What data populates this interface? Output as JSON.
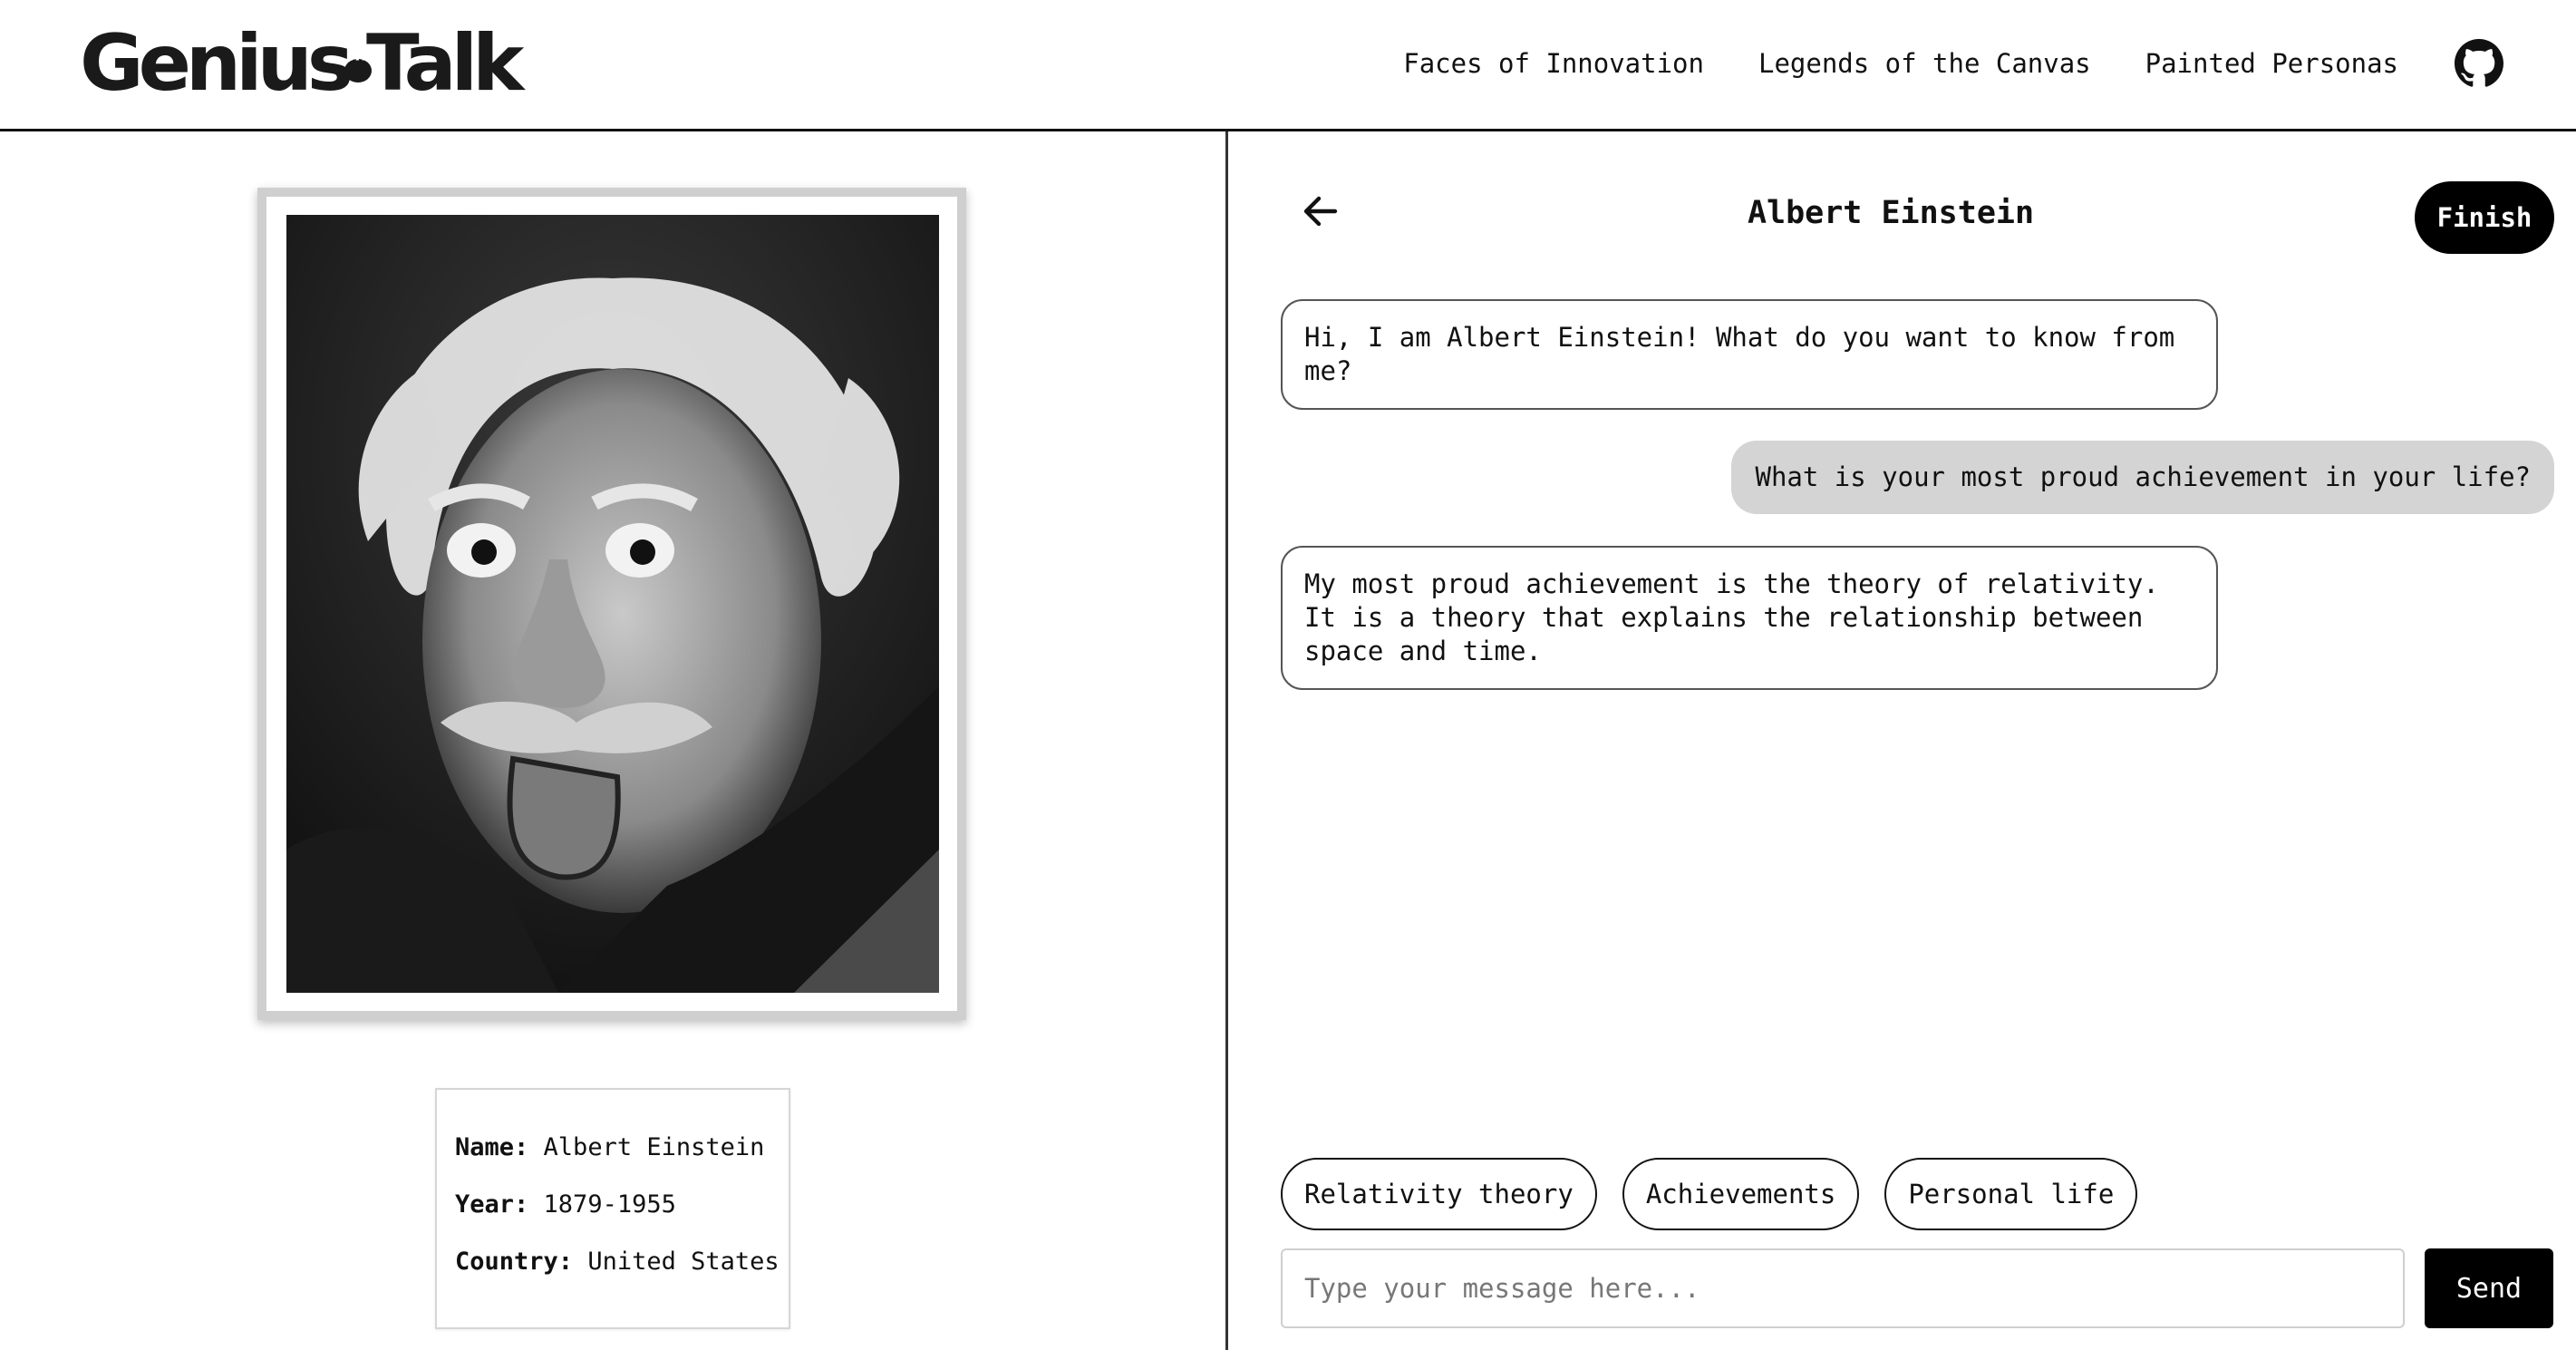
{
  "app": {
    "logo_text_1": "Genius",
    "logo_text_2": "Talk"
  },
  "nav": {
    "items": [
      {
        "label": "Faces of Innovation"
      },
      {
        "label": "Legends of the Canvas"
      },
      {
        "label": "Painted Personas"
      }
    ],
    "github_icon": "github-icon"
  },
  "profile": {
    "portrait_alt": "Albert Einstein portrait",
    "fields": [
      {
        "key": "Name:",
        "value": "Albert Einstein"
      },
      {
        "key": "Year:",
        "value": "1879-1955"
      },
      {
        "key": "Country:",
        "value": "United States"
      }
    ]
  },
  "chat": {
    "title": "Albert Einstein",
    "finish_label": "Finish",
    "messages": [
      {
        "role": "bot",
        "text": "Hi, I am Albert Einstein! What do you want to know from me?"
      },
      {
        "role": "user",
        "text": "What is your most proud achievement in your life?"
      },
      {
        "role": "bot",
        "text": "My most proud achievement is the theory of relativity. It is a theory that explains the relationship between space and time."
      }
    ],
    "suggestions": [
      {
        "label": "Relativity theory"
      },
      {
        "label": "Achievements"
      },
      {
        "label": "Personal life"
      }
    ],
    "input_placeholder": "Type your message here...",
    "input_value": "",
    "send_label": "Send"
  },
  "colors": {
    "accent": "#000000",
    "user_bubble": "#d4d4d4",
    "frame": "#cfcfcf"
  }
}
